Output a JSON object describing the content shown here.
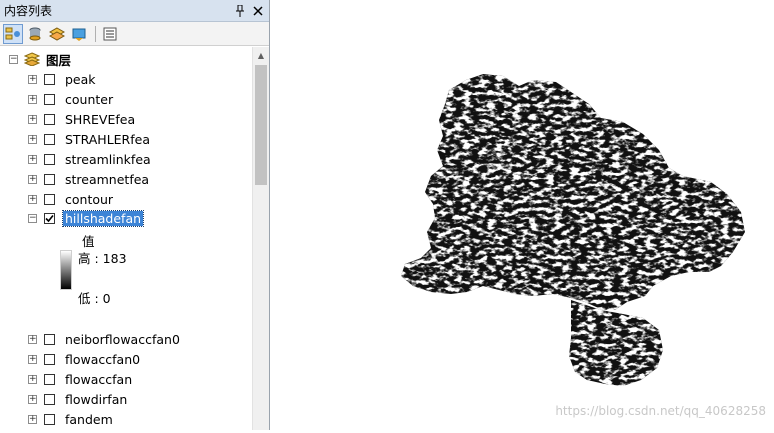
{
  "panel": {
    "title": "内容列表",
    "pin_glyph": "⌂",
    "close_glyph": "✕"
  },
  "toolbar": {
    "icons": [
      "list-by-drawing-order-icon",
      "list-by-source-icon",
      "list-by-visibility-icon",
      "list-by-selection-icon",
      "options-icon"
    ]
  },
  "tree": {
    "root_label": "图层",
    "layers_top": [
      "peak",
      "counter",
      "SHREVEfea",
      "STRAHLERfea",
      "streamlinkfea",
      "streamnetfea",
      "contour"
    ],
    "selected_layer": "hillshadefan",
    "legend": {
      "heading": "值",
      "high": "高 : 183",
      "low": "低 : 0"
    },
    "layers_bottom": [
      "neiborflowaccfan0",
      "flowaccfan0",
      "flowaccfan",
      "flowdirfan",
      "fandem"
    ]
  },
  "map": {
    "watermark": "https://blog.csdn.net/qq_40628258"
  },
  "colors": {
    "title_bar": "#d7e2ef",
    "selection": "#3d84d6"
  }
}
